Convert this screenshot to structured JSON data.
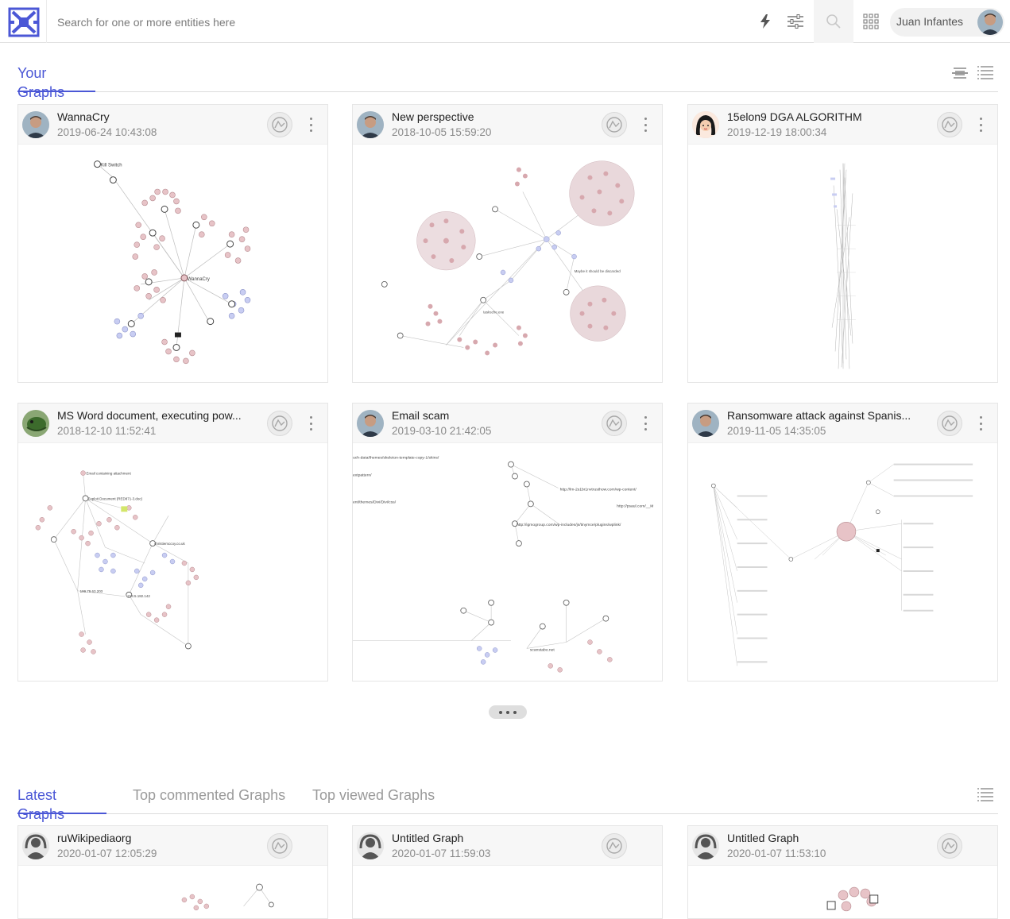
{
  "app": {
    "search_placeholder": "Search for one or more entities here",
    "user_name": "Juan Infantes",
    "accent_color": "#4b57d6"
  },
  "your_graphs": {
    "title": "Your Graphs",
    "cards": [
      {
        "title": "WannaCry",
        "date": "2019-06-24 10:43:08",
        "labels": [
          "Kill Switch",
          "WannaCry"
        ]
      },
      {
        "title": "New perspective",
        "date": "2018-10-05 15:59:20",
        "labels": [
          "Maybe it should be discarded",
          "tasksche.exe"
        ]
      },
      {
        "title": "15elon9 DGA ALGORITHM",
        "date": "2019-12-19 18:00:34",
        "labels": []
      },
      {
        "title": "MS Word document, executing pow...",
        "date": "2018-12-10 11:52:41",
        "labels": [
          "Email containing attachment",
          "Exploit Document (RED871-3.doc)",
          "christiemccoy.co.uk",
          "199.79.63.203",
          "213.5.182.142"
        ]
      },
      {
        "title": "Email scam",
        "date": "2019-03-10 21:42:05",
        "labels": [
          "http://lm-2s1br1nvtrusthow.com/wp-content/",
          "http://psaul.com/__M",
          "http://igmogroup.com/wp-includes/js/tinymce/plugins/wplink/",
          "uch-data/themes/skeleton-template-copy-1/skins/",
          "extpattern/",
          "ent/themes/Divi/Divi/css/",
          "scanstabo.net"
        ]
      },
      {
        "title": "Ransomware attack against Spanis...",
        "date": "2019-11-05 14:35:05",
        "labels": []
      }
    ]
  },
  "more_label": "more",
  "latest": {
    "tabs": [
      "Latest Graphs",
      "Top commented Graphs",
      "Top viewed Graphs"
    ],
    "cards": [
      {
        "title": "ruWikipediaorg",
        "date": "2020-01-07 12:05:29"
      },
      {
        "title": "Untitled Graph",
        "date": "2020-01-07 11:59:03"
      },
      {
        "title": "Untitled Graph",
        "date": "2020-01-07 11:53:10"
      }
    ]
  },
  "icons": {
    "logo": "virustotal-graph-logo",
    "lightning": "lightning-icon",
    "filters": "sliders-icon",
    "search": "search-icon",
    "apps": "apps-grid-icon",
    "density": "compact-view-icon",
    "list": "list-view-icon",
    "badge": "graph-badge-icon",
    "menu": "kebab-menu-icon"
  }
}
